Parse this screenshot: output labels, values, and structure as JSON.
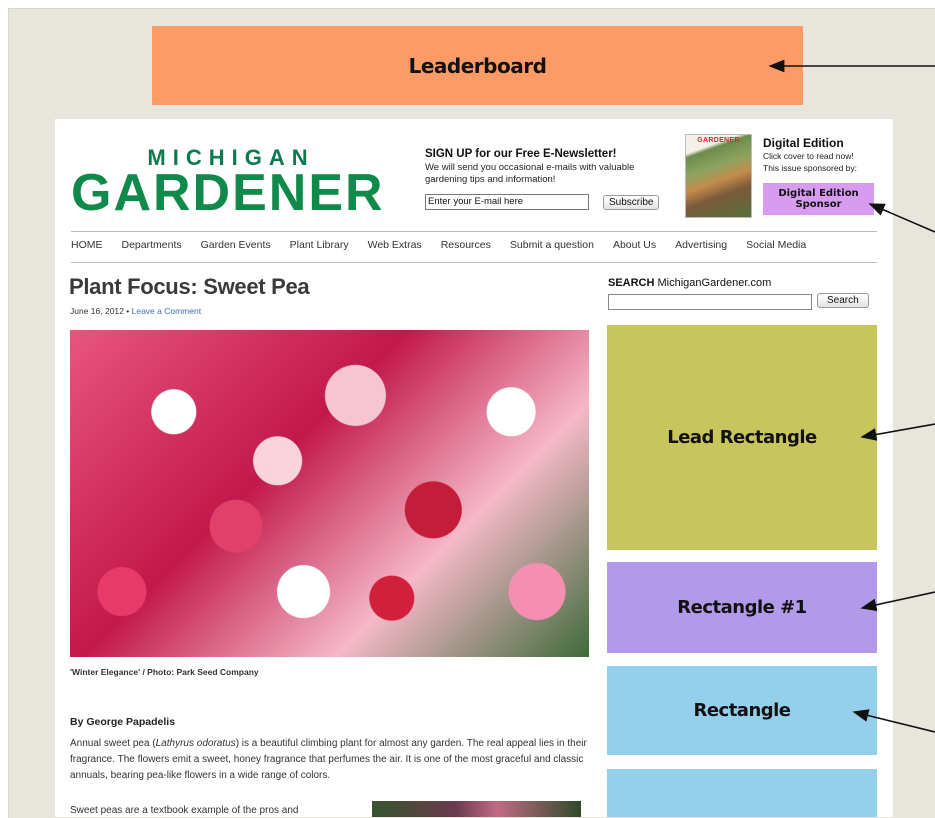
{
  "ad_labels": {
    "leaderboard": "Leaderboard",
    "lead_rectangle": "Lead Rectangle",
    "rectangle_1": "Rectangle #1",
    "rectangle": "Rectangle",
    "digital_edition_sponsor": "Digital Edition Sponsor"
  },
  "header": {
    "logo_line1": "MICHIGAN",
    "logo_line2": "GARDENER",
    "newsletter": {
      "heading": "SIGN UP for our Free E-Newsletter!",
      "text": "We will send you occasional e-mails with valuable gardening tips and information!",
      "email_value": "Enter your E-mail here",
      "button": "Subscribe"
    },
    "cover_title": "GARDENER",
    "digital_edition": {
      "title": "Digital Edition",
      "line1": "Click cover to read now!",
      "line2": "This issue sponsored by:"
    }
  },
  "nav": {
    "items": [
      "HOME",
      "Departments",
      "Garden Events",
      "Plant Library",
      "Web Extras",
      "Resources",
      "Submit a question",
      "About Us",
      "Advertising",
      "Social Media"
    ]
  },
  "article": {
    "title": "Plant Focus: Sweet Pea",
    "date": "June 16, 2012",
    "separator": "•",
    "comment_link": "Leave a Comment",
    "caption": "'Winter Elegance' / Photo: Park Seed Company",
    "byline": "By George Papadelis",
    "para1_before": "Annual sweet pea (",
    "para1_italic": "Lathyrus odoratus",
    "para1_after": ") is a beautiful climbing plant for almost any garden. The real appeal lies in their fragrance. The flowers emit a sweet, honey fragrance that perfumes the air. It is one of the most graceful and classic annuals, bearing pea-like flowers in a wide range of colors.",
    "para2": "Sweet peas are a textbook example of the pros and"
  },
  "sidebar": {
    "search_label_bold": "SEARCH",
    "search_label_rest": " MichiganGardener.com",
    "search_button": "Search"
  },
  "colors": {
    "leaderboard": "#fd9b66",
    "lead_rectangle": "#c9c55d",
    "rectangle_1": "#b29aea",
    "rectangle": "#94cfec",
    "sponsor": "#d79cf0",
    "logo_green": "#0f8a4a"
  }
}
